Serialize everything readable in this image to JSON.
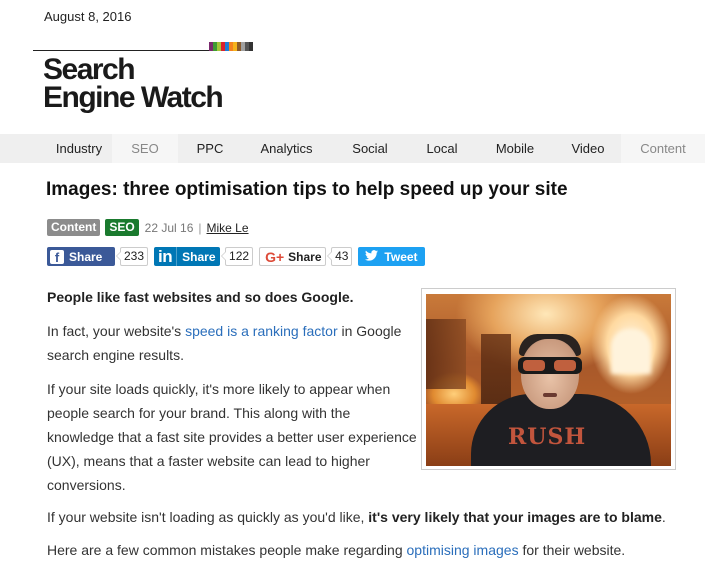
{
  "header": {
    "date": "August 8, 2016",
    "logo_line1": "Search",
    "logo_line2": "Engine Watch",
    "stripe_colors": [
      "#7b2a6e",
      "#3f9c35",
      "#a4c639",
      "#d9232e",
      "#1c7cd5",
      "#f4821f",
      "#f6b21b",
      "#8a5a2b",
      "#a0a0a0",
      "#555555",
      "#333333"
    ]
  },
  "nav": {
    "items": [
      {
        "label": "Industry"
      },
      {
        "label": "SEO"
      },
      {
        "label": "PPC"
      },
      {
        "label": "Analytics"
      },
      {
        "label": "Social"
      },
      {
        "label": "Local"
      },
      {
        "label": "Mobile"
      },
      {
        "label": "Video"
      },
      {
        "label": "Content"
      }
    ]
  },
  "article": {
    "title": "Images: three optimisation tips to help speed up your site",
    "tags": [
      "Content",
      "SEO"
    ],
    "date": "22 Jul 16",
    "separator": "|",
    "author": "Mike Le",
    "social": {
      "facebook": {
        "label": "Share",
        "count": "233"
      },
      "linkedin": {
        "label": "Share",
        "count": "122",
        "icon_text": "in"
      },
      "googleplus": {
        "label": "Share",
        "count": "43",
        "icon_text": "G+"
      },
      "twitter": {
        "label": "Tweet"
      }
    },
    "lead": "People like fast websites and so does Google.",
    "p1_before": "In fact, your website's ",
    "p1_link": "speed is a ranking factor",
    "p1_after": " in Google search engine results.",
    "p2": "If your site loads quickly, it's more likely to appear when people search for your brand. This along with the knowledge that a fast site provides a better user experience (UX), means that a faster website can lead to higher conversions.",
    "p3_before": "If your website isn't loading as quickly as you'd like, ",
    "p3_bold": "it's very likely that your images are to blame",
    "p3_after": ".",
    "p4_before": "Here are a few common mistakes people make regarding ",
    "p4_link": "optimising images",
    "p4_after": " for their website.",
    "image": {
      "shirt_text": "RUSH"
    }
  }
}
